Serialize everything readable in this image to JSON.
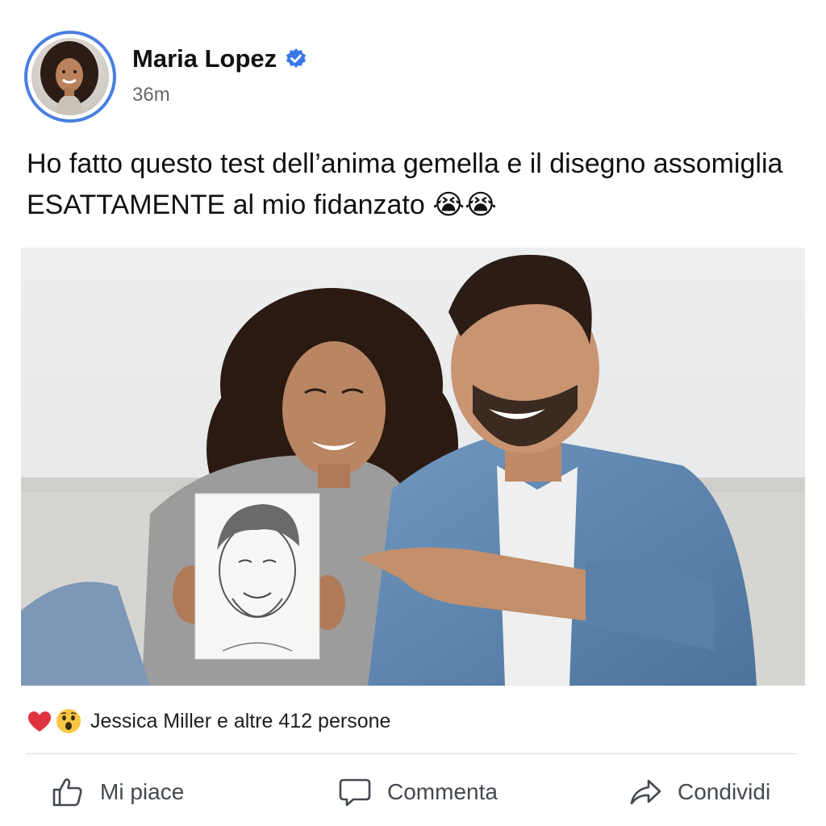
{
  "post": {
    "author": {
      "name": "Maria Lopez",
      "verified": true,
      "timestamp": "36m",
      "avatar_icon": "profile-photo"
    },
    "text": "Ho fatto questo test dell’anima gemella e il disegno assomiglia ESATTAMENTE al mio fidanzato 😭😭",
    "photo": {
      "icon": "couple-with-sketch-photo"
    },
    "reactions": {
      "icons": [
        "heart",
        "wow"
      ],
      "summary": "Jessica Miller e altre 412 persone"
    },
    "actions": {
      "like_label": "Mi piace",
      "comment_label": "Commenta",
      "share_label": "Condividi"
    }
  },
  "colors": {
    "accent": "#4a7fe0",
    "verified": "#3b78e7",
    "text": "#111111",
    "muted": "#65676b",
    "divider": "#d6d9dd"
  }
}
